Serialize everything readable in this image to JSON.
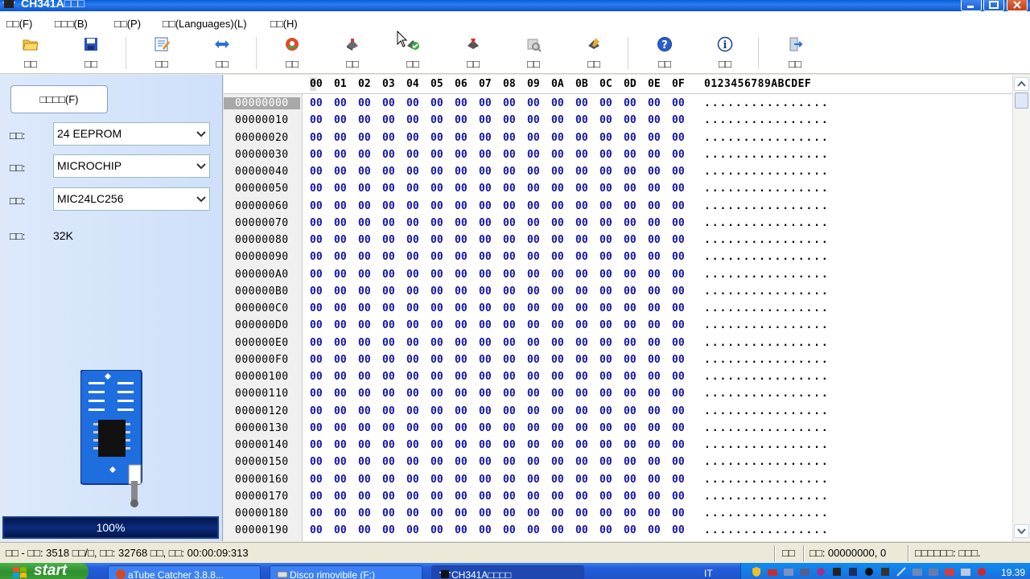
{
  "window": {
    "title": "CH341A□□□",
    "colors": {
      "titlebar": "#0a5fd8",
      "accent": "#1111aa"
    }
  },
  "menu": [
    {
      "label": "□□(F)"
    },
    {
      "label": "□□□(B)"
    },
    {
      "label": "□□(P)"
    },
    {
      "label": "□□(Languages)(L)"
    },
    {
      "label": "□□(H)"
    }
  ],
  "toolbar": [
    {
      "label": "□□",
      "icon": "open-folder-icon"
    },
    {
      "label": "□□",
      "icon": "save-disk-icon"
    },
    {
      "label": "□□",
      "icon": "edit-icon"
    },
    {
      "label": "□□",
      "icon": "swap-arrows-icon"
    },
    {
      "label": "□□",
      "icon": "detect-chip-icon"
    },
    {
      "label": "□□",
      "icon": "erase-icon"
    },
    {
      "label": "□□",
      "icon": "blank-check-icon"
    },
    {
      "label": "□□",
      "icon": "read-icon"
    },
    {
      "label": "□□",
      "icon": "program-icon"
    },
    {
      "label": "□□",
      "icon": "verify-icon"
    },
    {
      "label": "□□",
      "icon": "help-icon"
    },
    {
      "label": "□□",
      "icon": "about-icon"
    },
    {
      "label": "□□",
      "icon": "exit-icon"
    }
  ],
  "left": {
    "open_file_label": "□□□□(F)",
    "type_label": "□□:",
    "type_value": "24 EEPROM",
    "maker_label": "□□:",
    "maker_value": "MICROCHIP",
    "model_label": "□□:",
    "model_value": "MIC24LC256",
    "capacity_label": "□□:",
    "capacity_value": "32K",
    "progress_text": "100%",
    "progress_percent": 100
  },
  "hex": {
    "columns": [
      "00",
      "01",
      "02",
      "03",
      "04",
      "05",
      "06",
      "07",
      "08",
      "09",
      "0A",
      "0B",
      "0C",
      "0D",
      "0E",
      "0F"
    ],
    "ascii_header": "0123456789ABCDEF",
    "addresses": [
      "00000000",
      "00000010",
      "00000020",
      "00000030",
      "00000040",
      "00000050",
      "00000060",
      "00000070",
      "00000080",
      "00000090",
      "000000A0",
      "000000B0",
      "000000C0",
      "000000D0",
      "000000E0",
      "000000F0",
      "00000100",
      "00000110",
      "00000120",
      "00000130",
      "00000140",
      "00000150",
      "00000160",
      "00000170",
      "00000180",
      "00000190"
    ],
    "byte_value": "00",
    "ascii_row": "................",
    "selected_row": 0
  },
  "status": {
    "left": "□□ - □□: 3518 □□/□, □□: 32768 □□, □□: 00:00:09:313",
    "mid_label": "□□",
    "position": "□□: 00000000, 0",
    "right": "□□□□□□: □□□."
  },
  "taskbar": {
    "start_label": "start",
    "tasks": [
      {
        "label": "aTube Catcher 3.8.8...",
        "icon": "atube-icon"
      },
      {
        "label": "Disco rimovibile (F:)",
        "icon": "drive-icon"
      },
      {
        "label": "CH341A□□□□",
        "icon": "chip-app-icon"
      }
    ],
    "lang": "IT",
    "clock": "19.39"
  }
}
